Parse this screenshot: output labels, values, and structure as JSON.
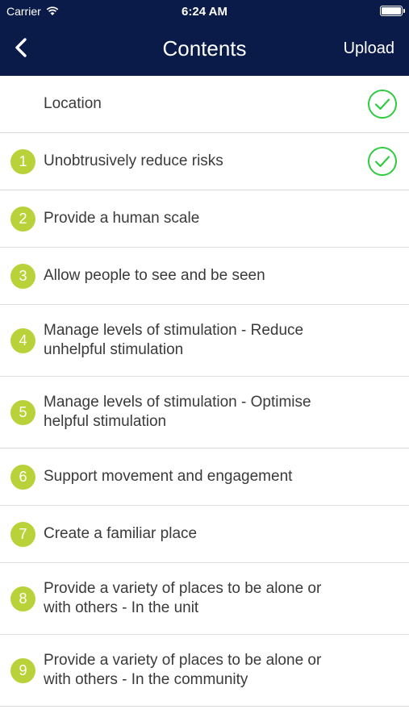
{
  "status_bar": {
    "carrier": "Carrier",
    "time": "6:24 AM"
  },
  "nav": {
    "title": "Contents",
    "upload_label": "Upload",
    "back_icon": "chevron-left-icon"
  },
  "colors": {
    "header": "#0b1b49",
    "badge": "#b9d23a",
    "check": "#2ecc40"
  },
  "items": [
    {
      "number": "",
      "label": "Location",
      "completed": true
    },
    {
      "number": "1",
      "label": "Unobtrusively reduce risks",
      "completed": true
    },
    {
      "number": "2",
      "label": "Provide a human scale",
      "completed": false
    },
    {
      "number": "3",
      "label": "Allow people to see and be seen",
      "completed": false
    },
    {
      "number": "4",
      "label": "Manage levels of stimulation - Reduce unhelpful stimulation",
      "completed": false
    },
    {
      "number": "5",
      "label": "Manage levels of stimulation - Optimise helpful stimulation",
      "completed": false
    },
    {
      "number": "6",
      "label": "Support movement and engagement",
      "completed": false
    },
    {
      "number": "7",
      "label": "Create a familiar place",
      "completed": false
    },
    {
      "number": "8",
      "label": "Provide a variety of places to be alone or with others - In the unit",
      "completed": false
    },
    {
      "number": "9",
      "label": "Provide a variety of places to be alone or with others - In the community",
      "completed": false
    }
  ]
}
